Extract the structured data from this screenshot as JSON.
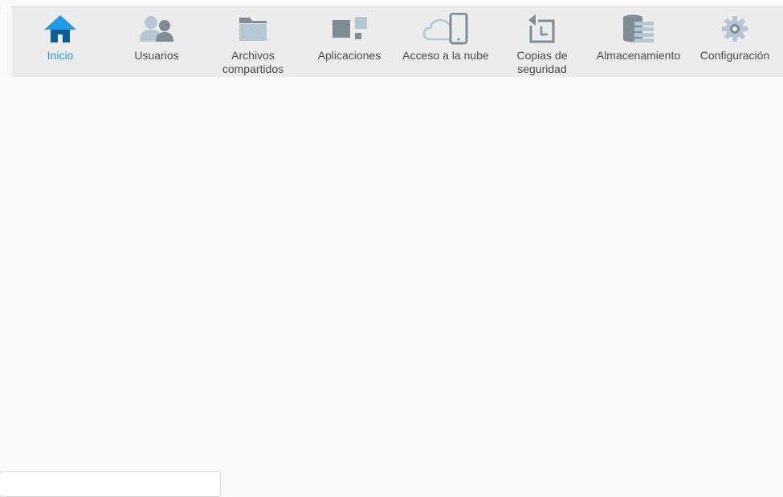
{
  "colors": {
    "active": "#1e9be6",
    "active_dark": "#0b5d93",
    "icon_gray": "#7f8c95",
    "icon_light": "#b4c7d3"
  },
  "nav": {
    "items": [
      {
        "label": "Inicio",
        "icon": "home-icon",
        "active": true
      },
      {
        "label": "Usuarios",
        "icon": "users-icon",
        "active": false
      },
      {
        "label": "Archivos\ncompartidos",
        "icon": "folder-icon",
        "active": false
      },
      {
        "label": "Aplicaciones",
        "icon": "apps-icon",
        "active": false
      },
      {
        "label": "Acceso a la nube",
        "icon": "cloud-phone-icon",
        "active": false
      },
      {
        "label": "Copias de\nseguridad",
        "icon": "backup-icon",
        "active": false
      },
      {
        "label": "Almacenamiento",
        "icon": "storage-icon",
        "active": false
      },
      {
        "label": "Configuración",
        "icon": "gear-icon",
        "active": false
      }
    ]
  }
}
